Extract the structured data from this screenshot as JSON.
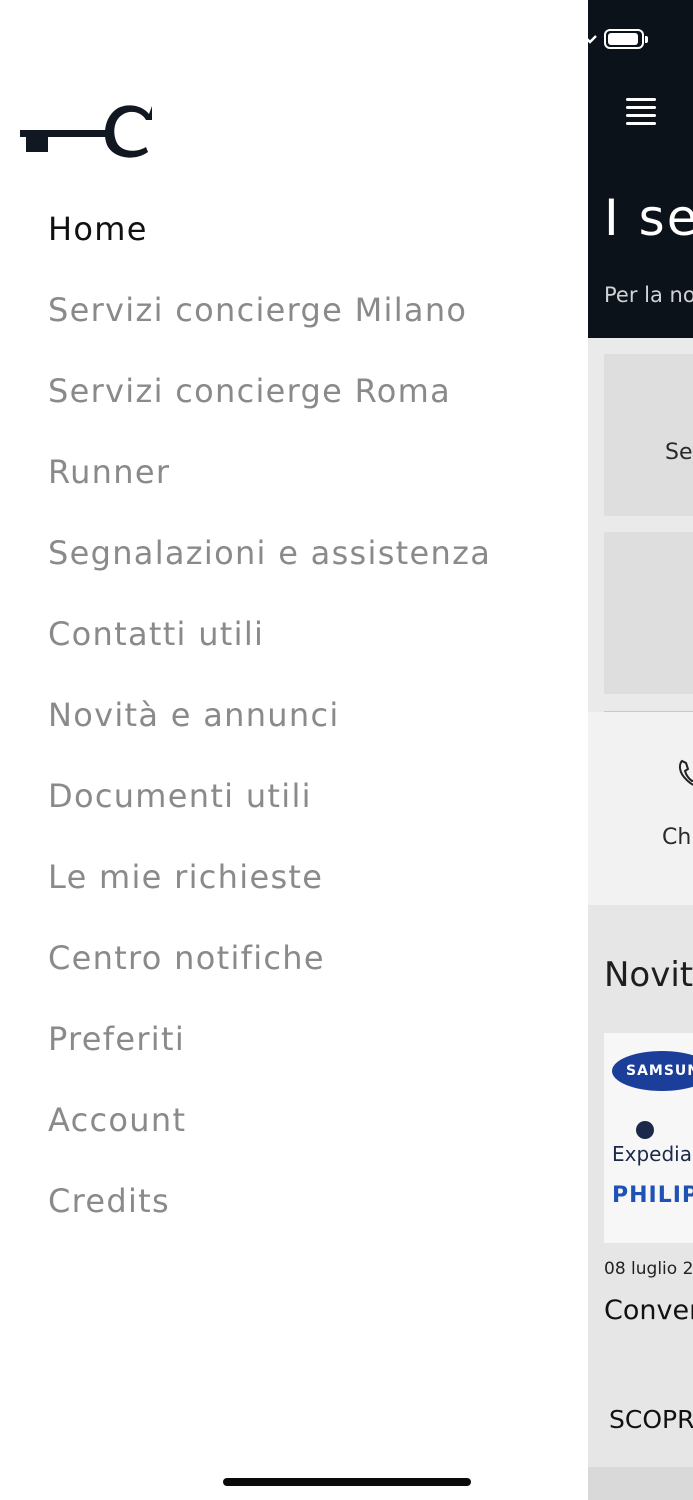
{
  "main": {
    "title": "I se",
    "subtitle": "Per la no",
    "card_label": "Se",
    "row_label": "Ch",
    "news_title": "Novit",
    "news_card": {
      "logos": [
        "SAMSUNG",
        "Expedia",
        "PHILIPS"
      ],
      "date": "08 luglio 2",
      "heading": "Conven",
      "cta": "SCOPRI"
    }
  },
  "drawer": {
    "logo_icon": "key-c-logo",
    "menu": [
      {
        "label": "Home",
        "active": true
      },
      {
        "label": "Servizi concierge Milano"
      },
      {
        "label": "Servizi concierge Roma"
      },
      {
        "label": "Runner"
      },
      {
        "label": "Segnalazioni e assistenza"
      },
      {
        "label": "Contatti utili"
      },
      {
        "label": "Novità e annunci"
      },
      {
        "label": "Documenti utili"
      },
      {
        "label": "Le mie richieste"
      },
      {
        "label": "Centro notifiche"
      },
      {
        "label": "Preferiti"
      },
      {
        "label": "Account"
      },
      {
        "label": "Credits"
      }
    ]
  },
  "colors": {
    "header_bg": "#0c121a",
    "menu_active": "#111111",
    "menu_inactive": "#8a8a8a"
  }
}
